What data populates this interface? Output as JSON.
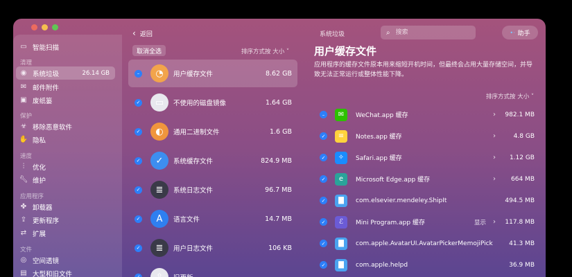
{
  "window": {
    "title": "系统垃圾"
  },
  "toolbar": {
    "back_label": "返回",
    "search_placeholder": "搜索",
    "assistant_label": "助手"
  },
  "sidebar": {
    "top_item": {
      "label": "智能扫描",
      "icon": "monitor-icon"
    },
    "sections": [
      {
        "title": "清理",
        "items": [
          {
            "label": "系统垃圾",
            "size": "26.14 GB",
            "active": true,
            "icon": "trash-circle-icon"
          },
          {
            "label": "邮件附件",
            "icon": "mail-icon"
          },
          {
            "label": "废纸篓",
            "icon": "bin-icon"
          }
        ]
      },
      {
        "title": "保护",
        "items": [
          {
            "label": "移除恶意软件",
            "icon": "biohazard-icon"
          },
          {
            "label": "隐私",
            "icon": "hand-icon"
          }
        ]
      },
      {
        "title": "速度",
        "items": [
          {
            "label": "优化",
            "icon": "sliders-icon"
          },
          {
            "label": "维护",
            "icon": "wrench-icon"
          }
        ]
      },
      {
        "title": "应用程序",
        "items": [
          {
            "label": "卸载器",
            "icon": "uninstaller-icon"
          },
          {
            "label": "更新程序",
            "icon": "update-icon"
          },
          {
            "label": "扩展",
            "icon": "extension-icon"
          }
        ]
      },
      {
        "title": "文件",
        "items": [
          {
            "label": "空间透镜",
            "icon": "lens-icon"
          },
          {
            "label": "大型和旧文件",
            "icon": "folder-icon"
          }
        ]
      }
    ]
  },
  "categories": {
    "deselect_label": "取消全选",
    "sort_label": "排序方式按 大小 ˅",
    "items": [
      {
        "label": "用户缓存文件",
        "size": "8.62 GB",
        "active": true,
        "state": "partial",
        "icon": "user-cache-icon"
      },
      {
        "label": "不使用的磁盘镜像",
        "size": "1.64 GB",
        "state": "checked",
        "icon": "disk-image-icon"
      },
      {
        "label": "通用二进制文件",
        "size": "1.6 GB",
        "state": "checked",
        "icon": "universal-binary-icon"
      },
      {
        "label": "系统缓存文件",
        "size": "824.9 MB",
        "state": "checked",
        "icon": "system-cache-icon"
      },
      {
        "label": "系统日志文件",
        "size": "96.7 MB",
        "state": "checked",
        "icon": "system-log-icon"
      },
      {
        "label": "语言文件",
        "size": "14.7 MB",
        "state": "checked",
        "icon": "language-file-icon"
      },
      {
        "label": "用户日志文件",
        "size": "106 KB",
        "state": "checked",
        "icon": "user-log-icon"
      },
      {
        "label": "旧更新",
        "size": "",
        "state": "checked",
        "icon": "old-update-icon"
      }
    ]
  },
  "detail": {
    "title": "用户缓存文件",
    "description": "应用程序的缓存文件原本用来缩短开机时间，但最终会占用大量存储空间，并导致无法正常运行或整体性能下降。",
    "sort_label": "排序方式按 大小 ˅",
    "items": [
      {
        "name": "WeChat.app 缓存",
        "size": "982.1 MB",
        "state": "partial",
        "arrow": "›",
        "icon": "wechat-icon",
        "color": "#2dc100"
      },
      {
        "name": "Notes.app 缓存",
        "size": "4.8 GB",
        "state": "checked",
        "arrow": "›",
        "icon": "notes-icon",
        "color": "#ffd33d"
      },
      {
        "name": "Safari.app 缓存",
        "size": "1.12 GB",
        "state": "checked",
        "arrow": "›",
        "icon": "safari-icon",
        "color": "#1a8cff"
      },
      {
        "name": "Microsoft Edge.app 缓存",
        "size": "664 MB",
        "state": "checked",
        "arrow": "›",
        "icon": "edge-icon",
        "color": "#2aa39a"
      },
      {
        "name": "com.elsevier.mendeley.ShipIt",
        "size": "494.5 MB",
        "state": "checked",
        "icon": "folder-icon",
        "color": "#4aa3f0"
      },
      {
        "name": "Mini Program.app 缓存",
        "size": "117.8 MB",
        "state": "checked",
        "extra": "显示",
        "arrow": "›",
        "icon": "mini-program-icon",
        "color": "#6b5bd6"
      },
      {
        "name": "com.apple.AvatarUI.AvatarPickerMemojiPick",
        "size": "41.3 MB",
        "state": "checked",
        "icon": "folder-icon",
        "color": "#4aa3f0"
      },
      {
        "name": "com.apple.helpd",
        "size": "36.9 MB",
        "state": "checked",
        "icon": "folder-icon",
        "color": "#4aa3f0"
      }
    ]
  }
}
